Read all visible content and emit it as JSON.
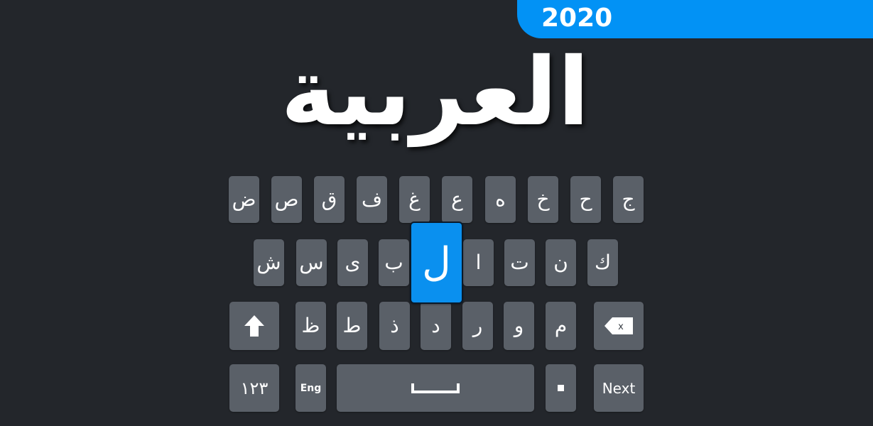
{
  "banner": {
    "text": "2020",
    "color": "#0292f5"
  },
  "title": "العربية",
  "colors": {
    "background": "#23262b",
    "key": "#5a6068",
    "key_active": "#0a90ef",
    "text": "#ffffff"
  },
  "keyboard": {
    "row1": [
      "ض",
      "ص",
      "ق",
      "ف",
      "غ",
      "ع",
      "ه",
      "خ",
      "ح",
      "ج"
    ],
    "row2": [
      "ش",
      "س",
      "ى",
      "ب",
      "ل",
      "ا",
      "ت",
      "ن",
      "ك"
    ],
    "row3": [
      "ظ",
      "ط",
      "ذ",
      "د",
      "ر",
      "و",
      "م"
    ],
    "active_key": "ل",
    "shift_icon": "shift-arrow-up-icon",
    "backspace_icon": "backspace-icon",
    "backspace_glyph": "x",
    "numbers_label": "١٢٣",
    "language_label": "Eng",
    "space_icon": "space-bar-icon",
    "period_label": ".",
    "action_label": "Next"
  }
}
